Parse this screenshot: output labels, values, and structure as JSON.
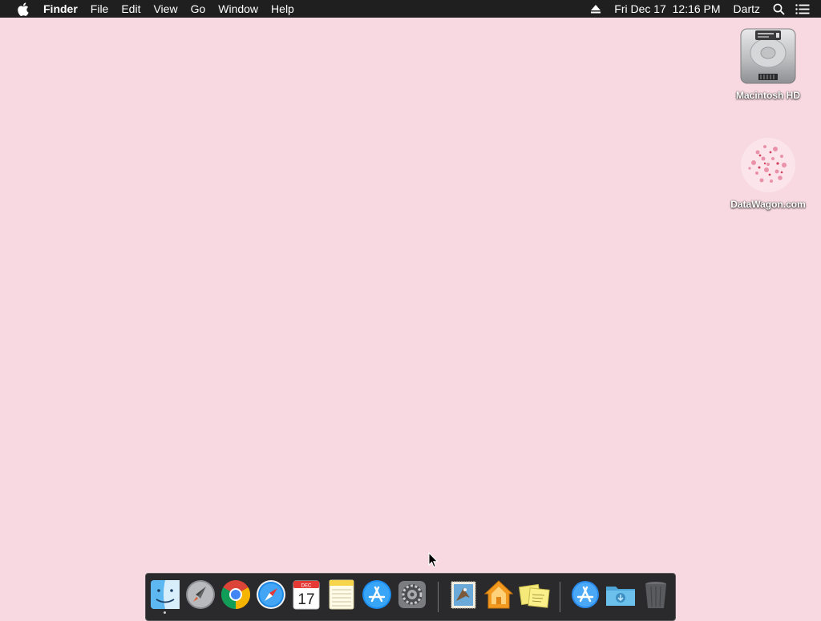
{
  "menubar": {
    "apple_icon": "apple-icon",
    "app_name": "Finder",
    "menus": [
      "File",
      "Edit",
      "View",
      "Go",
      "Window",
      "Help"
    ],
    "eject_icon": "eject-icon",
    "clock": "Fri Dec 17  12:16 PM",
    "user": "Dartz",
    "search_icon": "spotlight-search-icon",
    "notification_icon": "notification-center-icon"
  },
  "desktop": {
    "background_color": "#f8d9e2",
    "icons": [
      {
        "label": "Macintosh HD",
        "icon": "hard-drive-icon"
      },
      {
        "label": "DataWagon.com",
        "icon": "disk-image-icon"
      }
    ]
  },
  "dock": {
    "items": [
      {
        "name": "Finder",
        "icon": "finder-icon",
        "running": true
      },
      {
        "name": "Launchpad",
        "icon": "launchpad-icon"
      },
      {
        "name": "Google Chrome",
        "icon": "chrome-icon"
      },
      {
        "name": "Safari",
        "icon": "safari-icon"
      },
      {
        "name": "Calendar",
        "icon": "calendar-icon",
        "month": "DEC",
        "day": "17"
      },
      {
        "name": "Notes",
        "icon": "notes-icon"
      },
      {
        "name": "App Store",
        "icon": "app-store-icon"
      },
      {
        "name": "System Preferences",
        "icon": "system-preferences-icon"
      },
      {
        "name": "Mail",
        "icon": "mail-icon"
      },
      {
        "name": "Home",
        "icon": "home-icon"
      },
      {
        "name": "Stickies",
        "icon": "stickies-icon"
      },
      {
        "name": "Applications",
        "icon": "applications-folder-icon"
      },
      {
        "name": "Downloads",
        "icon": "downloads-folder-icon"
      },
      {
        "name": "Trash",
        "icon": "trash-icon"
      }
    ]
  }
}
